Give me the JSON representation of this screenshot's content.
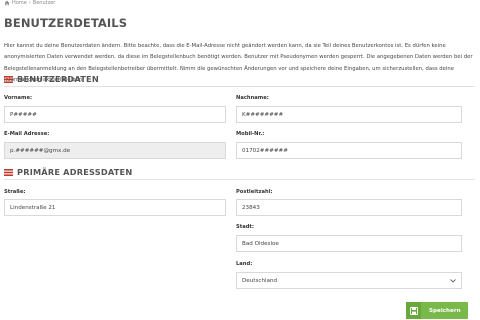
{
  "breadcrumb": {
    "home": "Home",
    "separator": "›",
    "current": "Benutzer"
  },
  "page_title": "Benutzerdetails",
  "intro_text": "Hier kannst du deine Benutzerdaten ändern. Bitte beachte, dass die E-Mail-Adresse nicht geändert werden kann, da sie Teil deines Benutzerkontos ist. Es dürfen keine anonymisierten Daten verwendet werden, da diese im Belegstellenbuch benötigt werden. Benutzer mit Pseudonymen werden gesperrt. Die angegebenen Daten werden bei der Belegstellenanmeldung an den Belegstellenbetreiber übermittelt. Nimm die gewünschten Änderungen vor und speichere deine Eingaben, um sicherzustellen, dass deine Informationen aktuell bleiben.",
  "sections": {
    "user": {
      "title": "Benutzerdaten"
    },
    "address": {
      "title": "Primäre Adressdaten"
    }
  },
  "fields": {
    "vorname": {
      "label": "Vorname:",
      "value": "P#####"
    },
    "nachname": {
      "label": "Nachname:",
      "value": "K########"
    },
    "email": {
      "label": "E-Mail Adresse:",
      "value": "p.######@gmx.de"
    },
    "mobil": {
      "label": "Mobil-Nr.:",
      "value": "01702######"
    },
    "strasse": {
      "label": "Straße:",
      "value": "Lindenstraße 21"
    },
    "plz": {
      "label": "Postleitzahl:",
      "value": "23843"
    },
    "stadt": {
      "label": "Stadt:",
      "value": "Bad Oldesloe"
    },
    "land": {
      "label": "Land:",
      "value": "Deutschland"
    }
  },
  "save_button": {
    "label": "Speichern"
  },
  "colors": {
    "accent_green": "#79b94a",
    "flag_red": "#c0392b",
    "readonly_bg": "#eeeeee"
  }
}
